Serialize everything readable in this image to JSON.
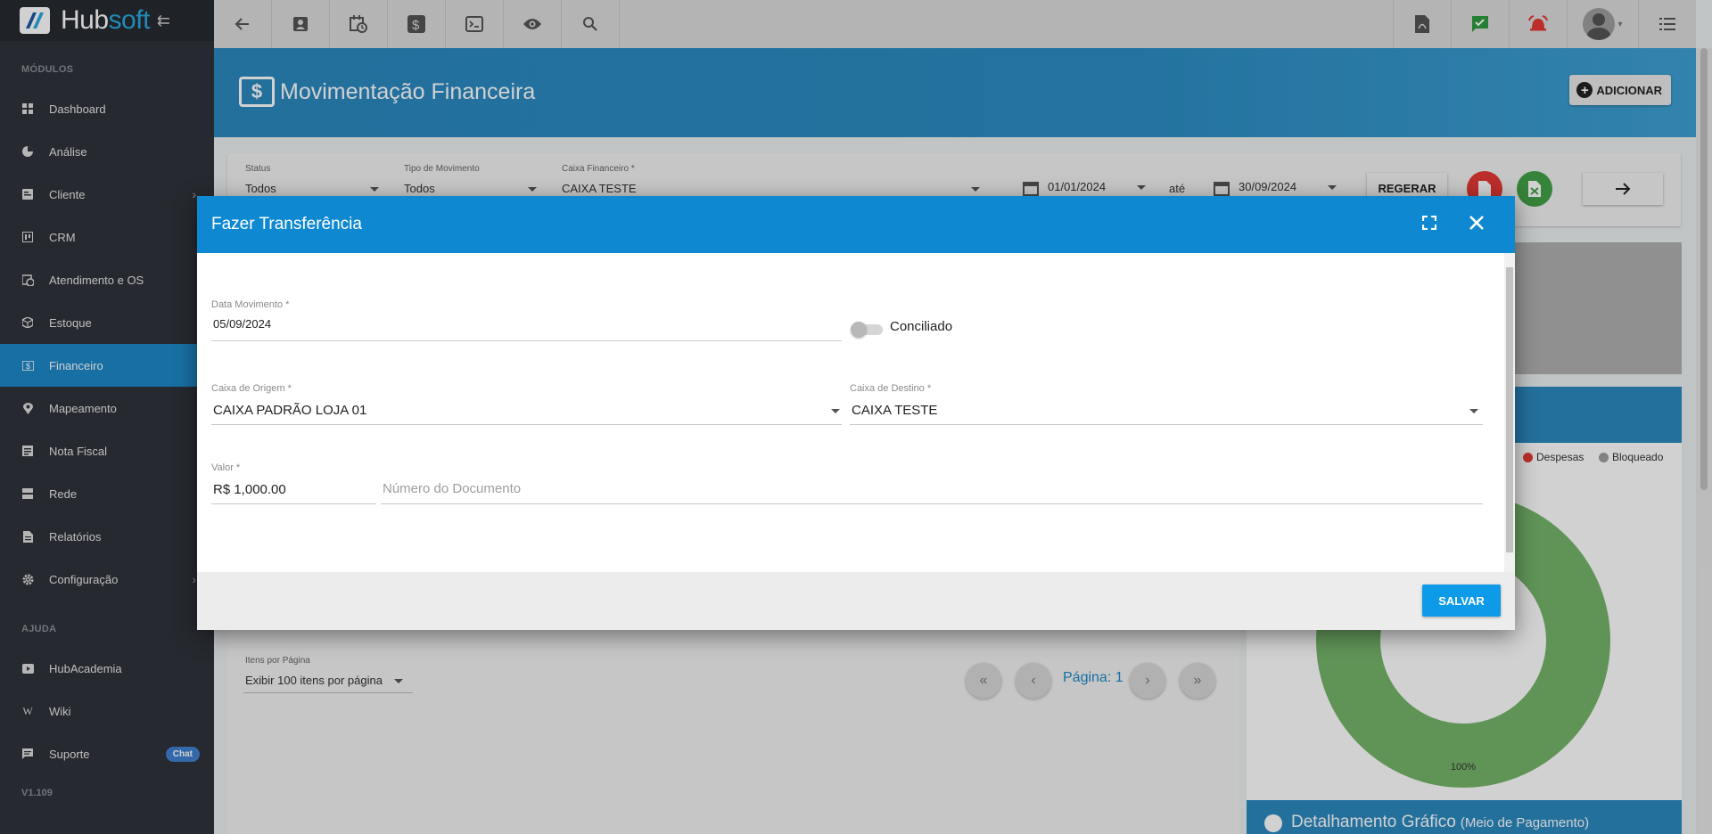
{
  "brand": {
    "name_part1": "Hub",
    "name_part2": "soft"
  },
  "sidebar": {
    "section_modules": "MÓDULOS",
    "modules": [
      {
        "label": "Dashboard",
        "icon": "dashboard-icon"
      },
      {
        "label": "Análise",
        "icon": "pie-chart-icon"
      },
      {
        "label": "Cliente",
        "icon": "contact-card-icon",
        "has_submenu": true
      },
      {
        "label": "CRM",
        "icon": "kanban-icon"
      },
      {
        "label": "Atendimento e OS",
        "icon": "calendar-clock-icon"
      },
      {
        "label": "Estoque",
        "icon": "box-icon"
      },
      {
        "label": "Financeiro",
        "icon": "money-icon",
        "active": true
      },
      {
        "label": "Mapeamento",
        "icon": "map-pin-icon"
      },
      {
        "label": "Nota Fiscal",
        "icon": "receipt-icon"
      },
      {
        "label": "Rede",
        "icon": "server-icon"
      },
      {
        "label": "Relatórios",
        "icon": "document-icon"
      },
      {
        "label": "Configuração",
        "icon": "gear-icon",
        "has_submenu": true
      }
    ],
    "section_help": "AJUDA",
    "help": [
      {
        "label": "HubAcademia",
        "icon": "play-icon"
      },
      {
        "label": "Wiki",
        "icon": "wiki-icon"
      },
      {
        "label": "Suporte",
        "icon": "chat-icon",
        "badge": "Chat"
      }
    ],
    "version": "V1.109"
  },
  "topbar": {
    "left_icons": [
      "back-arrow-icon",
      "contact-card-icon",
      "calendar-clock-icon",
      "dollar-icon",
      "terminal-icon",
      "eye-icon",
      "search-icon"
    ],
    "right_icons": [
      "pdf-icon",
      "check-message-icon",
      "alarm-bell-icon",
      "user-avatar",
      "menu-list-icon"
    ]
  },
  "page": {
    "title": "Movimentação Financeira",
    "add_button": "ADICIONAR"
  },
  "filters": {
    "status_label": "Status",
    "status_value": "Todos",
    "tipo_label": "Tipo de Movimento",
    "tipo_value": "Todos",
    "caixa_label": "Caixa Financeiro *",
    "caixa_value": "CAIXA TESTE",
    "date_from": "01/01/2024",
    "ate": "até",
    "date_to": "30/09/2024",
    "regerar": "REGERAR"
  },
  "pagination": {
    "per_page_label": "Itens por Página",
    "per_page_value": "Exibir 100 itens por página",
    "page_text": "Página: 1"
  },
  "chart": {
    "legend": [
      "Despesas",
      "Bloqueado"
    ],
    "percent_label": "100%",
    "detail_title": "Detalhamento Gráfico",
    "detail_subtitle": "(Meio de Pagamento)"
  },
  "chart_data": {
    "type": "pie",
    "series": [
      {
        "values": [
          100
        ]
      }
    ],
    "legend": [
      "Despesas",
      "Bloqueado"
    ],
    "data_labels": [
      "100%"
    ],
    "colors": [
      "#76b56b"
    ]
  },
  "modal": {
    "title": "Fazer Transferência",
    "data_label": "Data Movimento *",
    "data_value": "05/09/2024",
    "conciliado_label": "Conciliado",
    "conciliado_on": false,
    "origem_label": "Caixa de Origem *",
    "origem_value": "CAIXA PADRÃO LOJA 01",
    "destino_label": "Caixa de Destino *",
    "destino_value": "CAIXA TESTE",
    "valor_label": "Valor *",
    "valor_value": "R$ 1,000.00",
    "documento_placeholder": "Número do Documento",
    "save_button": "SALVAR"
  },
  "colors": {
    "primary": "#0d88d1",
    "sidebar_bg": "#2f333a",
    "active_item": "#1e88c9",
    "pdf_red": "#e53935",
    "excel_green": "#43a047",
    "donut_green": "#76b56b",
    "despesas_red": "#e53935",
    "bloqueado_gray": "#9e9e9e"
  }
}
